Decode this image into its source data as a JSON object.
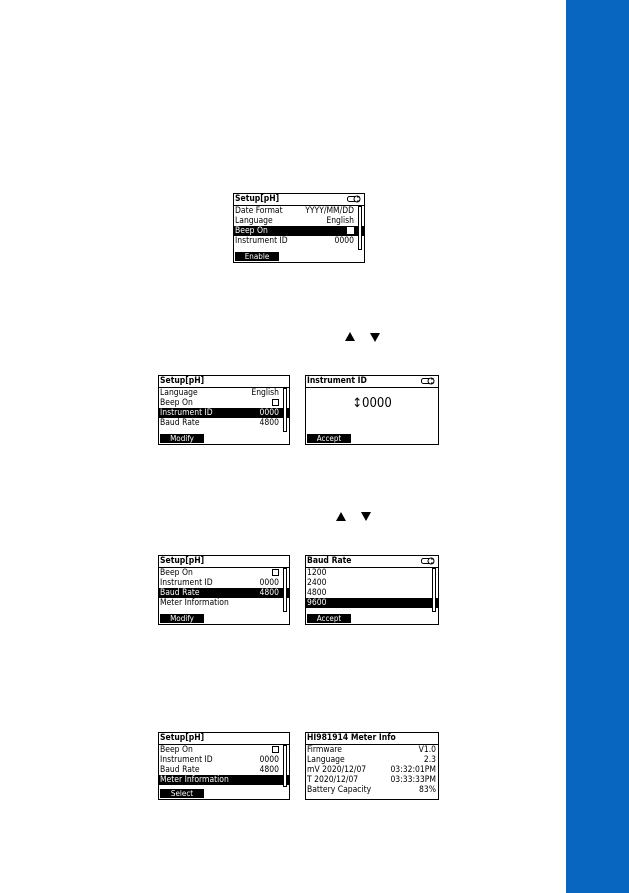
{
  "colors": {
    "sidebar": "#0866c0"
  },
  "screen1": {
    "title": "Setup[pH]",
    "rows": [
      {
        "label": "Date Format",
        "value": "YYYY/MM/DD"
      },
      {
        "label": "Language",
        "value": "English"
      },
      {
        "label": "Beep On",
        "value": "",
        "checkbox": true,
        "selected": true
      },
      {
        "label": "Instrument ID",
        "value": "0000"
      }
    ],
    "softkey": "Enable"
  },
  "arrows1": {
    "up": "up-arrow-key",
    "down": "down-arrow-key"
  },
  "screen2": {
    "title": "Setup[pH]",
    "rows": [
      {
        "label": "Language",
        "value": "English"
      },
      {
        "label": "Beep On",
        "value": "",
        "checkbox": true
      },
      {
        "label": "Instrument ID",
        "value": "0000",
        "selected": true
      },
      {
        "label": "Baud Rate",
        "value": "4800"
      }
    ],
    "softkey": "Modify"
  },
  "screen3": {
    "title": "Instrument ID",
    "value": "↕0000",
    "softkey": "Accept"
  },
  "arrows2": {
    "up": "up-arrow-key",
    "down": "down-arrow-key"
  },
  "screen4": {
    "title": "Setup[pH]",
    "rows": [
      {
        "label": "Beep On",
        "value": "",
        "checkbox": true
      },
      {
        "label": "Instrument ID",
        "value": "0000"
      },
      {
        "label": "Baud Rate",
        "value": "4800",
        "selected": true
      },
      {
        "label": "Meter Information",
        "value": ""
      }
    ],
    "softkey": "Modify"
  },
  "screen5": {
    "title": "Baud Rate",
    "rows": [
      {
        "label": "1200",
        "value": ""
      },
      {
        "label": "2400",
        "value": ""
      },
      {
        "label": "4800",
        "value": ""
      },
      {
        "label": "9600",
        "value": "",
        "selected": true
      }
    ],
    "softkey": "Accept"
  },
  "screen6": {
    "title": "Setup[pH]",
    "rows": [
      {
        "label": "Beep On",
        "value": "",
        "checkbox": true
      },
      {
        "label": "Instrument ID",
        "value": "0000"
      },
      {
        "label": "Baud Rate",
        "value": "4800"
      },
      {
        "label": "Meter Information",
        "value": "",
        "selected": true
      }
    ],
    "softkey": "Select"
  },
  "screen7": {
    "title": "HI981914 Meter Info",
    "rows": [
      {
        "label": "Firmware",
        "value": "V1.0"
      },
      {
        "label": "Language",
        "value": "2.3"
      },
      {
        "label": "mV   2020/12/07",
        "value": "03:32:01PM"
      },
      {
        "label": "T    2020/12/07",
        "value": "03:33:33PM"
      },
      {
        "label": "Battery Capacity",
        "value": "83%"
      }
    ]
  }
}
